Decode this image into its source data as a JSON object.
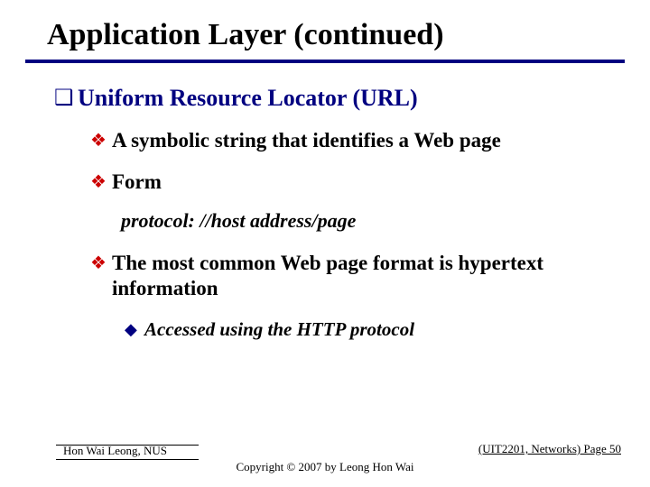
{
  "title": "Application Layer (continued)",
  "section": {
    "heading": "Uniform Resource Locator (URL)",
    "items": [
      {
        "text": "A symbolic string that identifies a Web page"
      },
      {
        "text": "Form",
        "code": "protocol: //host address/page"
      },
      {
        "text": "The most common Web page format is hypertext information",
        "sub": [
          "Accessed using the HTTP protocol"
        ]
      }
    ]
  },
  "footer": {
    "author": "Hon Wai Leong, NUS",
    "copyright": "Copyright © 2007 by Leong Hon Wai",
    "page": "(UIT2201, Networks) Page 50"
  }
}
